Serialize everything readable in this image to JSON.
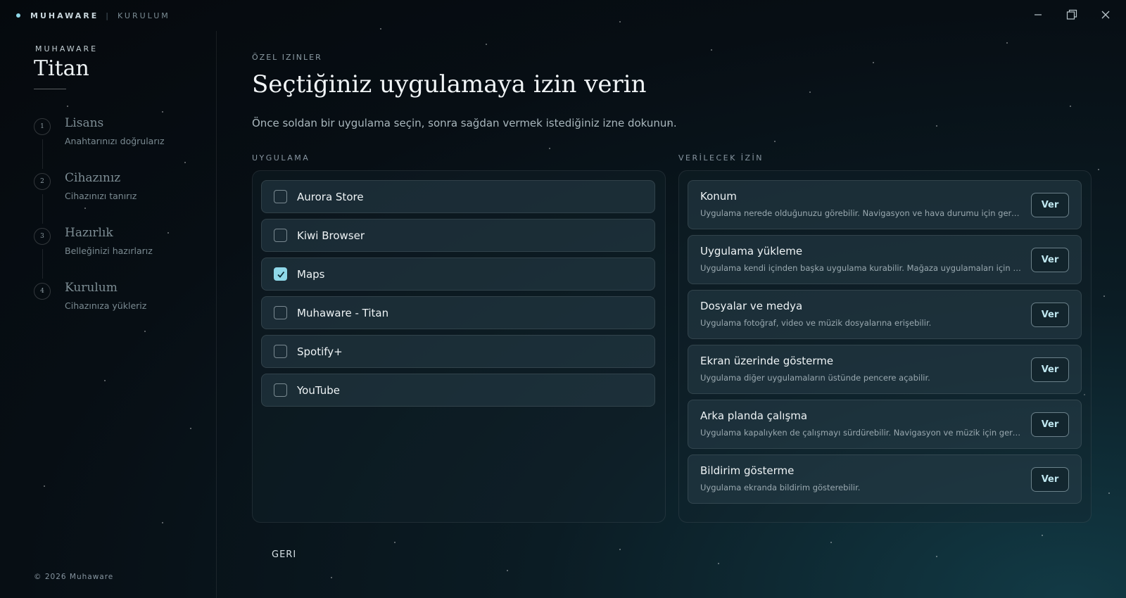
{
  "window": {
    "brand": "MUHAWARE",
    "section": "KURULUM",
    "controls": [
      "minimize",
      "maximize",
      "close"
    ]
  },
  "sidebar": {
    "brand": "MUHAWARE",
    "title": "Titan",
    "steps": [
      {
        "num": "1",
        "title": "Lisans",
        "desc": "Anahtarınızı doğrularız"
      },
      {
        "num": "2",
        "title": "Cihazınız",
        "desc": "Cihazınızı tanırız"
      },
      {
        "num": "3",
        "title": "Hazırlık",
        "desc": "Belleğinizi hazırlarız"
      },
      {
        "num": "4",
        "title": "Kurulum",
        "desc": "Cihazınıza yükleriz"
      }
    ],
    "copyright": "© 2026 Muhaware"
  },
  "main": {
    "eyebrow": "ÖZEL IZINLER",
    "heading": "Seçtiğiniz uygulamaya izin verin",
    "subtitle": "Önce soldan bir uygulama seçin, sonra sağdan vermek istediğiniz izne dokunun.",
    "apps_label": "UYGULAMA",
    "perms_label": "VERİLECEK İZİN",
    "apps": [
      {
        "name": "Aurora Store",
        "checked": false
      },
      {
        "name": "Kiwi Browser",
        "checked": false
      },
      {
        "name": "Maps",
        "checked": true
      },
      {
        "name": "Muhaware - Titan",
        "checked": false
      },
      {
        "name": "Spotify+",
        "checked": false
      },
      {
        "name": "YouTube",
        "checked": false
      }
    ],
    "permissions": [
      {
        "title": "Konum",
        "desc": "Uygulama nerede olduğunuzu görebilir. Navigasyon ve hava durumu için gerekir.",
        "button": "Ver"
      },
      {
        "title": "Uygulama yükleme",
        "desc": "Uygulama kendi içinden başka uygulama kurabilir. Mağaza uygulamaları için gerek...",
        "button": "Ver"
      },
      {
        "title": "Dosyalar ve medya",
        "desc": "Uygulama fotoğraf, video ve müzik dosyalarına erişebilir.",
        "button": "Ver"
      },
      {
        "title": "Ekran üzerinde gösterme",
        "desc": "Uygulama diğer uygulamaların üstünde pencere açabilir.",
        "button": "Ver"
      },
      {
        "title": "Arka planda çalışma",
        "desc": "Uygulama kapalıyken de çalışmayı sürdürebilir. Navigasyon ve müzik için gerekir.",
        "button": "Ver"
      },
      {
        "title": "Bildirim gösterme",
        "desc": "Uygulama ekranda bildirim gösterebilir.",
        "button": "Ver"
      }
    ],
    "back_label": "GERI"
  },
  "colors": {
    "accent": "#8fd8e8",
    "background": "#070e14",
    "card": "#1e323b"
  }
}
